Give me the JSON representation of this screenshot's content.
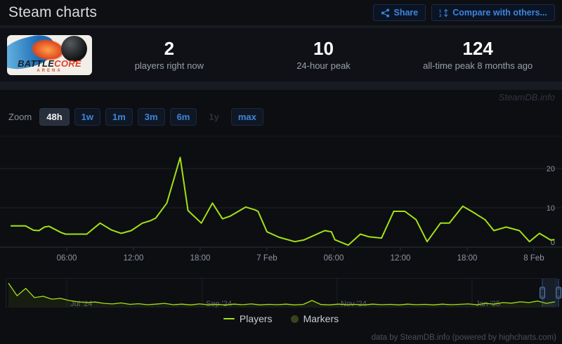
{
  "header": {
    "title": "Steam charts",
    "share_label": "Share",
    "compare_label": "Compare with others..."
  },
  "stats": {
    "capsule_title_part1": "BATTLE",
    "capsule_title_part2": "CORE",
    "capsule_subtitle": "ARENA",
    "items": [
      {
        "value": "2",
        "label": "players right now"
      },
      {
        "value": "10",
        "label": "24-hour peak"
      },
      {
        "value": "124",
        "label": "all-time peak 8 months ago"
      }
    ]
  },
  "chart_panel": {
    "watermark": "SteamDB.info",
    "zoom_label": "Zoom",
    "zoom_buttons": [
      {
        "label": "48h",
        "state": "selected"
      },
      {
        "label": "1w",
        "state": "normal"
      },
      {
        "label": "1m",
        "state": "normal"
      },
      {
        "label": "3m",
        "state": "normal"
      },
      {
        "label": "6m",
        "state": "normal"
      },
      {
        "label": "1y",
        "state": "disabled"
      },
      {
        "label": "max",
        "state": "normal"
      }
    ],
    "legend": [
      {
        "label": "Players",
        "symbol": "line",
        "color": "#a3e114"
      },
      {
        "label": "Markers",
        "symbol": "circle",
        "color": "#39421c"
      }
    ],
    "credits": "data by SteamDB.info (powered by highcharts.com)"
  },
  "chart_data": [
    {
      "type": "line",
      "title": "Players over last 48 hours",
      "series_name": "Players",
      "color": "#a3e114",
      "x_unit": "hours since 00:00 6 Feb",
      "x": [
        1.0,
        2.3,
        3.0,
        3.5,
        4.0,
        4.4,
        5.5,
        5.9,
        7.8,
        9.0,
        10.0,
        10.9,
        11.8,
        12.8,
        13.5,
        14.0,
        15.0,
        16.2,
        16.9,
        18.1,
        19.1,
        20.0,
        20.7,
        22.1,
        22.9,
        23.2,
        24.0,
        25.1,
        26.5,
        27.3,
        29.2,
        29.8,
        30.1,
        31.3,
        32.4,
        33.2,
        34.3,
        35.4,
        36.4,
        37.4,
        38.4,
        39.6,
        40.4,
        41.6,
        42.4,
        43.6,
        44.4,
        45.5,
        46.7,
        47.6,
        48.5,
        49.5,
        49.8
      ],
      "values": [
        5.4,
        5.4,
        4.3,
        4.2,
        5.1,
        5.3,
        3.7,
        3.3,
        3.3,
        6.1,
        4.4,
        3.5,
        4.2,
        6.1,
        6.7,
        7.4,
        11.2,
        22.8,
        9.3,
        6.1,
        11.2,
        7.2,
        7.9,
        10.2,
        9.5,
        9.1,
        3.9,
        2.5,
        1.4,
        1.8,
        4.2,
        3.9,
        1.9,
        0.5,
        3.3,
        2.6,
        2.3,
        9.1,
        9.1,
        7.0,
        1.4,
        6.1,
        6.1,
        10.4,
        9.1,
        7.0,
        4.2,
        5.1,
        4.2,
        1.4,
        3.5,
        1.8,
        1.9
      ],
      "xticks": [
        {
          "pos": 6,
          "label": "06:00"
        },
        {
          "pos": 12,
          "label": "12:00"
        },
        {
          "pos": 18,
          "label": "18:00"
        },
        {
          "pos": 24,
          "label": "7 Feb"
        },
        {
          "pos": 30,
          "label": "06:00"
        },
        {
          "pos": 36,
          "label": "12:00"
        },
        {
          "pos": 42,
          "label": "18:00"
        },
        {
          "pos": 48,
          "label": "8 Feb"
        }
      ],
      "yticks": [
        0,
        10,
        20
      ],
      "ylim": [
        0,
        29
      ],
      "grid": true,
      "legend_position": "bottom"
    },
    {
      "type": "area",
      "title": "Navigator: players Jun 2024 - Feb 2025",
      "series_name": "Players",
      "color": "#a3e114",
      "values": [
        124,
        58,
        96,
        48,
        55,
        40,
        44,
        33,
        26,
        22,
        25,
        18,
        15,
        20,
        13,
        16,
        11,
        14,
        18,
        11,
        14,
        10,
        15,
        11,
        13,
        10,
        14,
        11,
        15,
        10,
        13,
        11,
        14,
        10,
        13,
        33,
        12,
        10,
        14,
        11,
        13,
        10,
        14,
        11,
        13,
        10,
        14,
        11,
        13,
        10,
        14,
        11,
        13,
        15,
        11,
        18,
        14,
        22,
        19,
        26,
        22,
        30,
        18,
        26
      ],
      "ylim": [
        0,
        135
      ],
      "xticks": [
        {
          "frac": 0.1188,
          "label": "Jul '24"
        },
        {
          "frac": 0.36,
          "label": "Sep '24"
        },
        {
          "frac": 0.6,
          "label": "Nov '24"
        },
        {
          "frac": 0.84,
          "label": "Jan '25"
        }
      ],
      "selected_range_frac": [
        0.965,
        0.994
      ]
    }
  ]
}
